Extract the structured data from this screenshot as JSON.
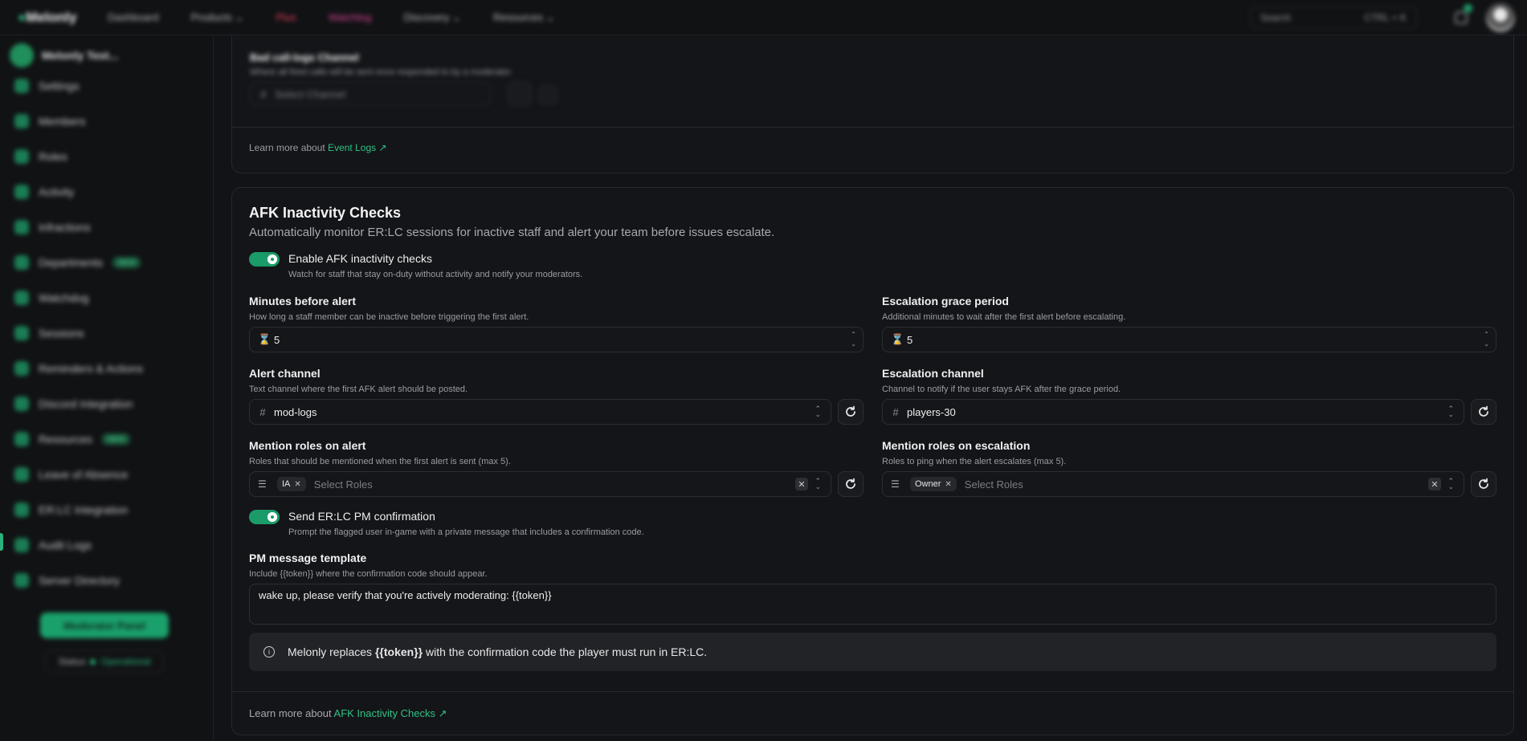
{
  "topbar": {
    "logo": "Melonly",
    "nav": [
      "Dashboard",
      "Products ⌄",
      "Plus",
      "Watchlog",
      "Discovery ⌄",
      "Resources ⌄"
    ],
    "search_label": "Search",
    "search_shortcut": "CTRL + K"
  },
  "sidebar": {
    "server_name": "Melonly Test...",
    "items": [
      {
        "label": "Settings"
      },
      {
        "label": "Members"
      },
      {
        "label": "Roles"
      },
      {
        "label": "Activity"
      },
      {
        "label": "Infractions"
      },
      {
        "label": "Departments",
        "badge": "NEW"
      },
      {
        "label": "Watchdog"
      },
      {
        "label": "Sessions"
      },
      {
        "label": "Reminders & Actions"
      },
      {
        "label": "Discord Integration"
      },
      {
        "label": "Resources",
        "badge": "NEW"
      },
      {
        "label": "Leave of Absence"
      },
      {
        "label": "ER:LC Integration"
      },
      {
        "label": "Audit Logs"
      },
      {
        "label": "Server Directory"
      }
    ],
    "mod_panel_label": "Moderator Panel",
    "status_label": "Status",
    "status_value": "Operational"
  },
  "top_card": {
    "title": "Bad call-logs Channel",
    "description": "Where all fired calls will be sent once responded to by a moderator.",
    "select_placeholder": "Select Channel",
    "learn_prefix": "Learn more about",
    "learn_link": "Event Logs"
  },
  "afk": {
    "title": "AFK Inactivity Checks",
    "description": "Automatically monitor ER:LC sessions for inactive staff and alert your team before issues escalate.",
    "enable_label": "Enable AFK inactivity checks",
    "enable_desc": "Watch for staff that stay on-duty without activity and notify your moderators.",
    "enabled": true,
    "minutes_label": "Minutes before alert",
    "minutes_desc": "How long a staff member can be inactive before triggering the first alert.",
    "minutes_value": "5",
    "grace_label": "Escalation grace period",
    "grace_desc": "Additional minutes to wait after the first alert before escalating.",
    "grace_value": "5",
    "alert_channel_label": "Alert channel",
    "alert_channel_desc": "Text channel where the first AFK alert should be posted.",
    "alert_channel_value": "mod-logs",
    "esc_channel_label": "Escalation channel",
    "esc_channel_desc": "Channel to notify if the user stays AFK after the grace period.",
    "esc_channel_value": "players-30",
    "mention_alert_label": "Mention roles on alert",
    "mention_alert_desc": "Roles that should be mentioned when the first alert is sent (max 5).",
    "mention_alert_chip": "IA",
    "mention_esc_label": "Mention roles on escalation",
    "mention_esc_desc": "Roles to ping when the alert escalates (max 5).",
    "mention_esc_chip": "Owner",
    "roles_placeholder": "Select Roles",
    "pm_label": "Send ER:LC PM confirmation",
    "pm_desc": "Prompt the flagged user in-game with a private message that includes a confirmation code.",
    "pm_enabled": true,
    "template_label": "PM message template",
    "template_desc": "Include {{token}} where the confirmation code should appear.",
    "template_value": "wake up, please verify that you're actively moderating: {{token}}",
    "info_prefix": "Melonly replaces",
    "info_token": "{{token}}",
    "info_suffix": "with the confirmation code the player must run in ER:LC.",
    "learn_prefix": "Learn more about",
    "learn_link": "AFK Inactivity Checks"
  },
  "colors": {
    "accent": "#1a9b69",
    "link": "#2fc285",
    "background": "#121316"
  }
}
